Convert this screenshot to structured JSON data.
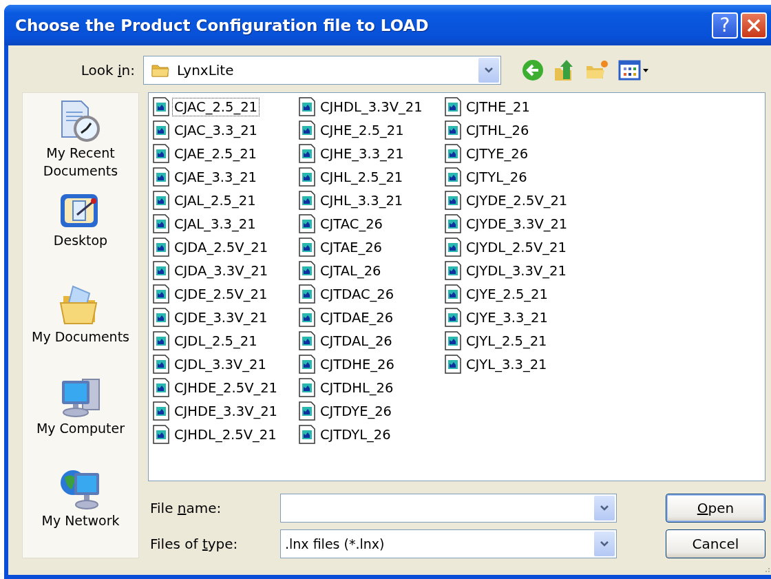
{
  "window": {
    "title": "Choose the Product Configuration file to LOAD",
    "help": "?"
  },
  "look_in": {
    "label_parts": {
      "before": "Look ",
      "key": "i",
      "after": "n:"
    },
    "value": "LynxLite"
  },
  "places": [
    {
      "kind": "recent",
      "label": "My Recent Documents"
    },
    {
      "kind": "desktop",
      "label": "Desktop"
    },
    {
      "kind": "documents",
      "label": "My Documents"
    },
    {
      "kind": "computer",
      "label": "My Computer"
    },
    {
      "kind": "network",
      "label": "My Network"
    }
  ],
  "files": [
    {
      "name": "CJAC_2.5_21",
      "focused": true
    },
    {
      "name": "CJAC_3.3_21",
      "focused": false
    },
    {
      "name": "CJAE_2.5_21",
      "focused": false
    },
    {
      "name": "CJAE_3.3_21",
      "focused": false
    },
    {
      "name": "CJAL_2.5_21",
      "focused": false
    },
    {
      "name": "CJAL_3.3_21",
      "focused": false
    },
    {
      "name": "CJDA_2.5V_21",
      "focused": false
    },
    {
      "name": "CJDA_3.3V_21",
      "focused": false
    },
    {
      "name": "CJDE_2.5V_21",
      "focused": false
    },
    {
      "name": "CJDE_3.3V_21",
      "focused": false
    },
    {
      "name": "CJDL_2.5_21",
      "focused": false
    },
    {
      "name": "CJDL_3.3V_21",
      "focused": false
    },
    {
      "name": "CJHDE_2.5V_21",
      "focused": false
    },
    {
      "name": "CJHDE_3.3V_21",
      "focused": false
    },
    {
      "name": "CJHDL_2.5V_21",
      "focused": false
    },
    {
      "name": "CJHDL_3.3V_21",
      "focused": false
    },
    {
      "name": "CJHE_2.5_21",
      "focused": false
    },
    {
      "name": "CJHE_3.3_21",
      "focused": false
    },
    {
      "name": "CJHL_2.5_21",
      "focused": false
    },
    {
      "name": "CJHL_3.3_21",
      "focused": false
    },
    {
      "name": "CJTAC_26",
      "focused": false
    },
    {
      "name": "CJTAE_26",
      "focused": false
    },
    {
      "name": "CJTAL_26",
      "focused": false
    },
    {
      "name": "CJTDAC_26",
      "focused": false
    },
    {
      "name": "CJTDAE_26",
      "focused": false
    },
    {
      "name": "CJTDAL_26",
      "focused": false
    },
    {
      "name": "CJTDHE_26",
      "focused": false
    },
    {
      "name": "CJTDHL_26",
      "focused": false
    },
    {
      "name": "CJTDYE_26",
      "focused": false
    },
    {
      "name": "CJTDYL_26",
      "focused": false
    },
    {
      "name": "CJTHE_21",
      "focused": false
    },
    {
      "name": "CJTHL_26",
      "focused": false
    },
    {
      "name": "CJTYE_26",
      "focused": false
    },
    {
      "name": "CJTYL_26",
      "focused": false
    },
    {
      "name": "CJYDE_2.5V_21",
      "focused": false
    },
    {
      "name": "CJYDE_3.3V_21",
      "focused": false
    },
    {
      "name": "CJYDL_2.5V_21",
      "focused": false
    },
    {
      "name": "CJYDL_3.3V_21",
      "focused": false
    },
    {
      "name": "CJYE_2.5_21",
      "focused": false
    },
    {
      "name": "CJYE_3.3_21",
      "focused": false
    },
    {
      "name": "CJYL_2.5_21",
      "focused": false
    },
    {
      "name": "CJYL_3.3_21",
      "focused": false
    }
  ],
  "file_name": {
    "label_parts": {
      "before": "File ",
      "key": "n",
      "after": "ame:"
    }
  },
  "file_type": {
    "label_parts": {
      "before": "Files of ",
      "key": "t",
      "after": "ype:"
    },
    "value": ".lnx files (*.lnx)"
  },
  "buttons": [
    {
      "kind": "default",
      "label_parts": {
        "key": "O",
        "after": "pen"
      }
    },
    {
      "kind": "normal",
      "label_parts": {
        "before": "Cancel"
      }
    }
  ]
}
